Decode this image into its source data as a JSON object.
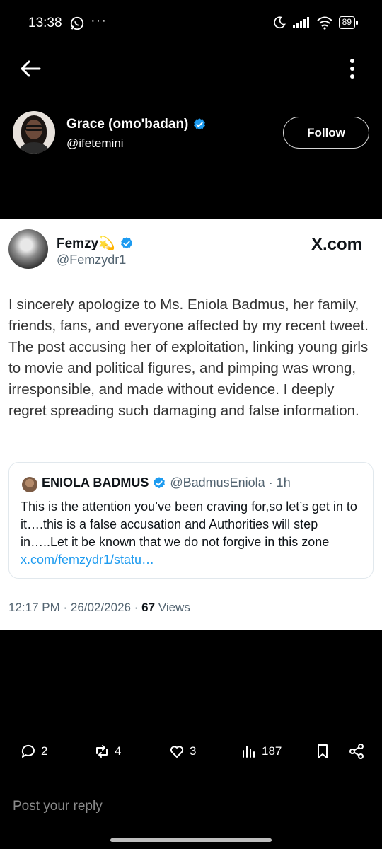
{
  "status_bar": {
    "time": "13:38",
    "overflow": "···",
    "battery": "89",
    "icons": [
      "whatsapp-icon",
      "moon-icon",
      "signal-icon",
      "wifi-icon",
      "battery-icon"
    ]
  },
  "nav": {
    "back_icon": "arrow-left-icon",
    "more_icon": "more-vertical-icon"
  },
  "poster": {
    "name": "Grace (omo'badan)",
    "handle": "@ifetemini",
    "follow_label": "Follow",
    "verified_color": "#1d9bf0"
  },
  "card": {
    "author_name": "Femzy💫",
    "author_handle": "@Femzydr1",
    "brand": "X.com",
    "text": "I sincerely apologize to Ms. Eniola Badmus, her family, friends, fans, and everyone affected by my recent tweet. The post accusing her of exploitation, linking young girls to movie and political figures, and pimping was wrong, irresponsible, and made without evidence. I deeply regret spreading such damaging and false information.",
    "quote": {
      "name": "ENIOLA BADMUS",
      "handle": "@BadmusEniola",
      "time": "· 1h",
      "text": "This is the attention you’ve been craving for,so let’s get in to it….this is a false accusation and Authorities will step in…..Let it be known that we do not forgive in this zone",
      "link": "x.com/femzydr1/statu…"
    },
    "time": "12:17 PM",
    "date": "26/02/2026",
    "sep": "·",
    "views_count": "67",
    "views_label": "Views"
  },
  "actions": {
    "replies": "2",
    "reposts": "4",
    "likes": "3",
    "views": "187"
  },
  "reply": {
    "placeholder": "Post your reply"
  },
  "colors": {
    "accent": "#1d9bf0",
    "background": "#000000",
    "card": "#ffffff"
  }
}
